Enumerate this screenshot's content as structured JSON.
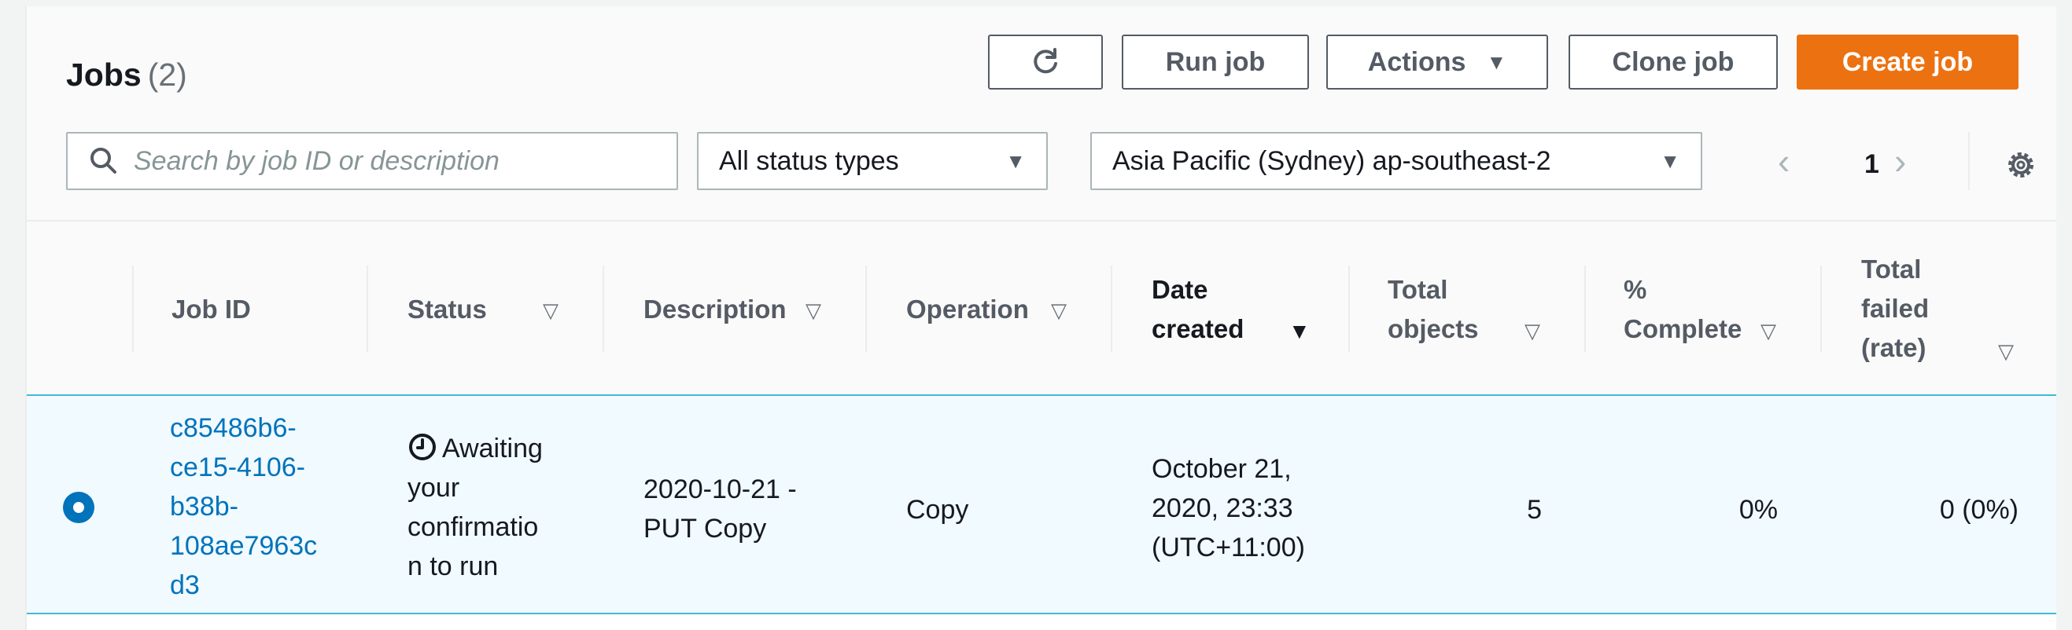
{
  "jobs": {
    "title": "Jobs",
    "count": "(2)"
  },
  "toolbar": {
    "run_job": "Run job",
    "actions": "Actions",
    "clone_job": "Clone job",
    "create_job": "Create job"
  },
  "filters": {
    "search_placeholder": "Search by job ID or description",
    "status": "All status types",
    "region": "Asia Pacific (Sydney) ap-southeast-2"
  },
  "pagination": {
    "page": "1"
  },
  "columns": {
    "job_id": "Job ID",
    "status": "Status",
    "description": "Description",
    "operation": "Operation",
    "date_created_1": "Date",
    "date_created_2": "created",
    "total_objects_1": "Total",
    "total_objects_2": "objects",
    "percent_1": "%",
    "percent_2": "Complete",
    "failed_1": "Total",
    "failed_2": "failed",
    "failed_3": "(rate)"
  },
  "rows": [
    {
      "job_id_lines": [
        "c85486b6-",
        "ce15-4106-",
        "b38b-",
        "108ae7963c",
        "d3"
      ],
      "status_lines": [
        "Awaiting",
        "your",
        "confirmatio",
        "n to run"
      ],
      "description_lines": [
        "2020-10-21 -",
        "PUT Copy"
      ],
      "operation": "Copy",
      "date_lines": [
        "October 21,",
        "2020, 23:33",
        "(UTC+11:00)"
      ],
      "total_objects": "5",
      "percent_complete": "0%",
      "total_failed": "0 (0%)"
    }
  ],
  "colors": {
    "primary": "#ec7211",
    "link": "#0073bb",
    "selected_row_bg": "#f1faff",
    "selected_row_border": "#44b9d6"
  }
}
